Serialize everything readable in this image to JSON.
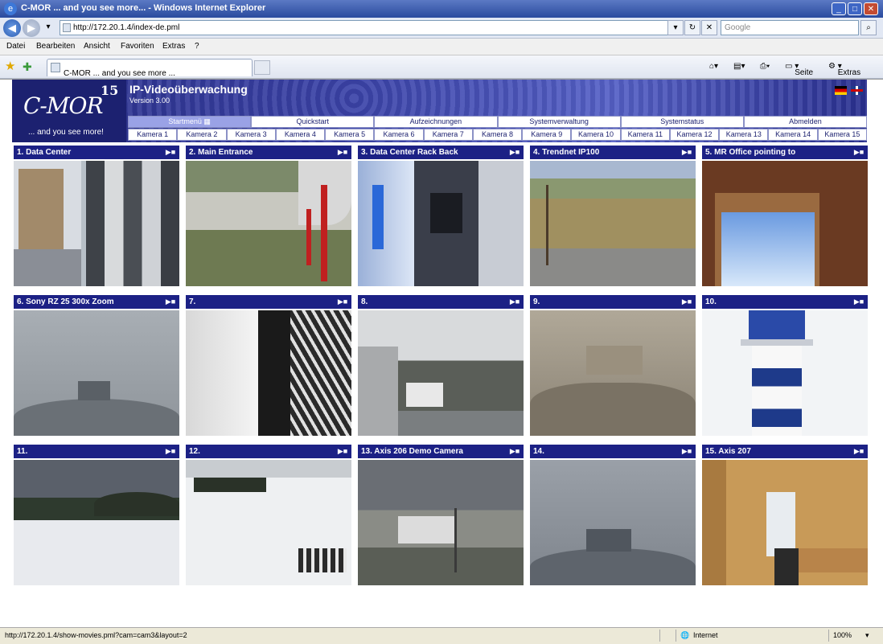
{
  "window": {
    "title": "C-MOR ... and you see more... - Windows Internet Explorer",
    "address": "http://172.20.1.4/index-de.pml",
    "search_placeholder": "Google",
    "tab_label": "C-MOR ... and you see more ...",
    "status_url": "http://172.20.1.4/show-movies.pml?cam=cam3&layout=2",
    "status_zone": "Internet",
    "zoom": "100%"
  },
  "menu": [
    "Datei",
    "Bearbeiten",
    "Ansicht",
    "Favoriten",
    "Extras",
    "?"
  ],
  "command_bar": {
    "page": "Seite",
    "tools": "Extras"
  },
  "app": {
    "logo": "C-MOR",
    "logo_sup": "15",
    "tagline": "... and you see more!",
    "title": "IP-Videoüberwachung",
    "version": "Version 3.00"
  },
  "main_nav": [
    {
      "label": "Startmenü"
    },
    {
      "label": "Quickstart"
    },
    {
      "label": "Aufzeichnungen"
    },
    {
      "label": "Systemverwaltung"
    },
    {
      "label": "Systemstatus"
    },
    {
      "label": "Abmelden"
    }
  ],
  "camera_nav": [
    "Kamera 1",
    "Kamera 2",
    "Kamera 3",
    "Kamera 4",
    "Kamera 5",
    "Kamera 6",
    "Kamera 7",
    "Kamera 8",
    "Kamera 9",
    "Kamera 10",
    "Kamera 11",
    "Kamera 12",
    "Kamera 13",
    "Kamera 14",
    "Kamera 15"
  ],
  "cameras": [
    {
      "title": "1. Data Center"
    },
    {
      "title": "2. Main Entrance"
    },
    {
      "title": "3. Data Center Rack Back"
    },
    {
      "title": "4. Trendnet IP100"
    },
    {
      "title": "5. MR Office pointing to"
    },
    {
      "title": "6. Sony RZ 25 300x Zoom"
    },
    {
      "title": "7."
    },
    {
      "title": "8."
    },
    {
      "title": "9."
    },
    {
      "title": "10."
    },
    {
      "title": "11."
    },
    {
      "title": "12."
    },
    {
      "title": "13. Axis 206 Demo Camera"
    },
    {
      "title": "14."
    },
    {
      "title": "15. Axis 207"
    }
  ]
}
